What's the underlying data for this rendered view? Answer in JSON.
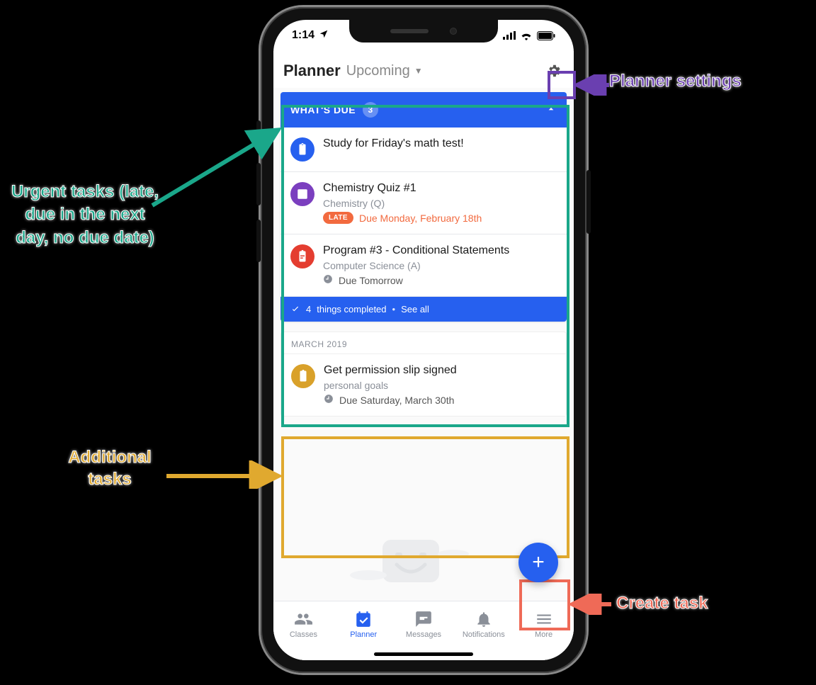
{
  "status": {
    "time": "1:14"
  },
  "header": {
    "title": "Planner",
    "filter": "Upcoming"
  },
  "due": {
    "label": "WHAT'S DUE",
    "count": "3",
    "items": [
      {
        "title": "Study for Friday's math test!"
      },
      {
        "title": "Chemistry Quiz #1",
        "course": "Chemistry (Q)",
        "late_tag": "LATE",
        "due": "Due Monday, February 18th"
      },
      {
        "title": "Program #3 - Conditional Statements",
        "course": "Computer Science (A)",
        "due": "Due Tomorrow"
      }
    ],
    "completed_count": "4",
    "completed_label": "things completed",
    "see_all": "See all"
  },
  "upcoming": {
    "month": "MARCH 2019",
    "items": [
      {
        "title": "Get permission slip signed",
        "subtitle": "personal goals",
        "due": "Due Saturday, March 30th"
      }
    ]
  },
  "fab": {
    "glyph": "+"
  },
  "tabs": {
    "classes": "Classes",
    "planner": "Planner",
    "messages": "Messages",
    "notifications": "Notifications",
    "more": "More"
  },
  "annotations": {
    "settings": "Planner settings",
    "urgent": "Urgent tasks (late, due in the next day, no due date)",
    "additional": "Additional tasks",
    "create": "Create task"
  }
}
